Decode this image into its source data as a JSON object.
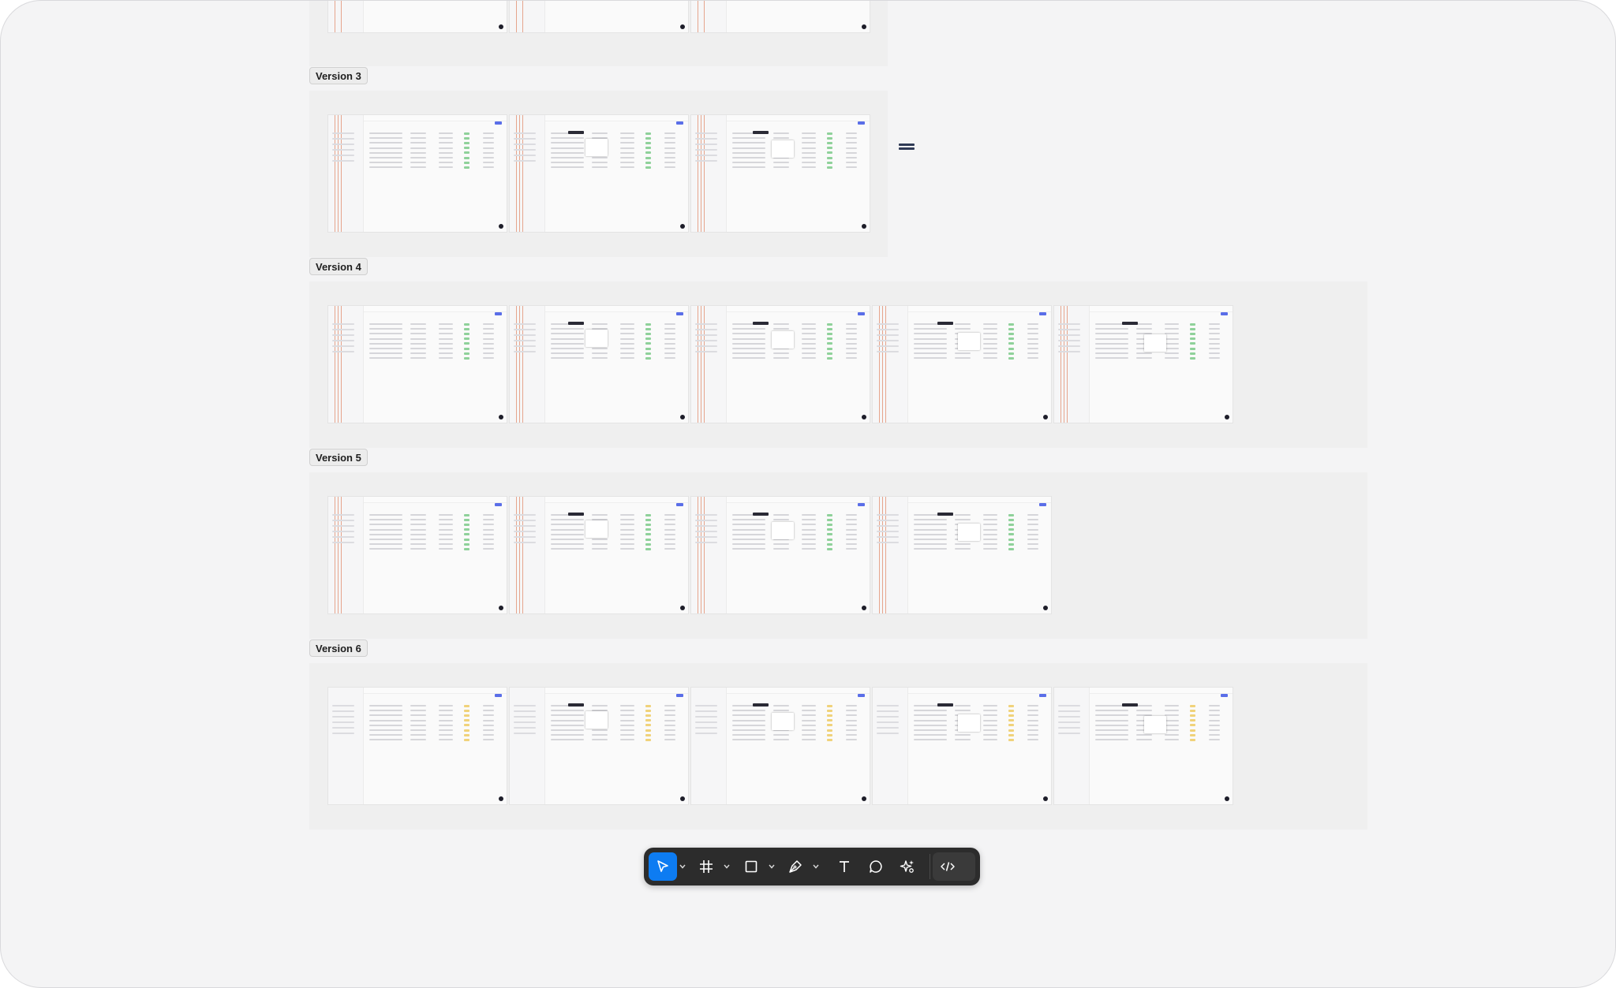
{
  "canvas": {
    "background": "#f4f4f5",
    "frame_background": "#efefef",
    "accent": "#0d7cf2",
    "red_guide_color": "#e08a6a",
    "primary_button_color": "#5a6ee8"
  },
  "versions": [
    {
      "label": "Version 3",
      "screens": 3
    },
    {
      "label": "Version 4",
      "screens": 5
    },
    {
      "label": "Version 5",
      "screens": 4
    },
    {
      "label": "Version 6",
      "screens": 5
    }
  ],
  "toolbar": {
    "tools": [
      {
        "name": "move-tool",
        "icon": "cursor-arrow-icon",
        "active": true,
        "has_menu": true
      },
      {
        "name": "frame-tool",
        "icon": "frame-grid-icon",
        "active": false,
        "has_menu": true
      },
      {
        "name": "shape-tool",
        "icon": "rectangle-icon",
        "active": false,
        "has_menu": true
      },
      {
        "name": "pen-tool",
        "icon": "pen-nib-icon",
        "active": false,
        "has_menu": true
      },
      {
        "name": "text-tool",
        "icon": "text-t-icon",
        "active": false,
        "has_menu": false
      },
      {
        "name": "comment-tool",
        "icon": "comment-bubble-icon",
        "active": false,
        "has_menu": false
      },
      {
        "name": "actions-tool",
        "icon": "sparkle-actions-icon",
        "active": false,
        "has_menu": false
      },
      {
        "name": "dev-mode-toggle",
        "icon": "code-brackets-icon",
        "active": false,
        "has_menu": false
      }
    ]
  }
}
